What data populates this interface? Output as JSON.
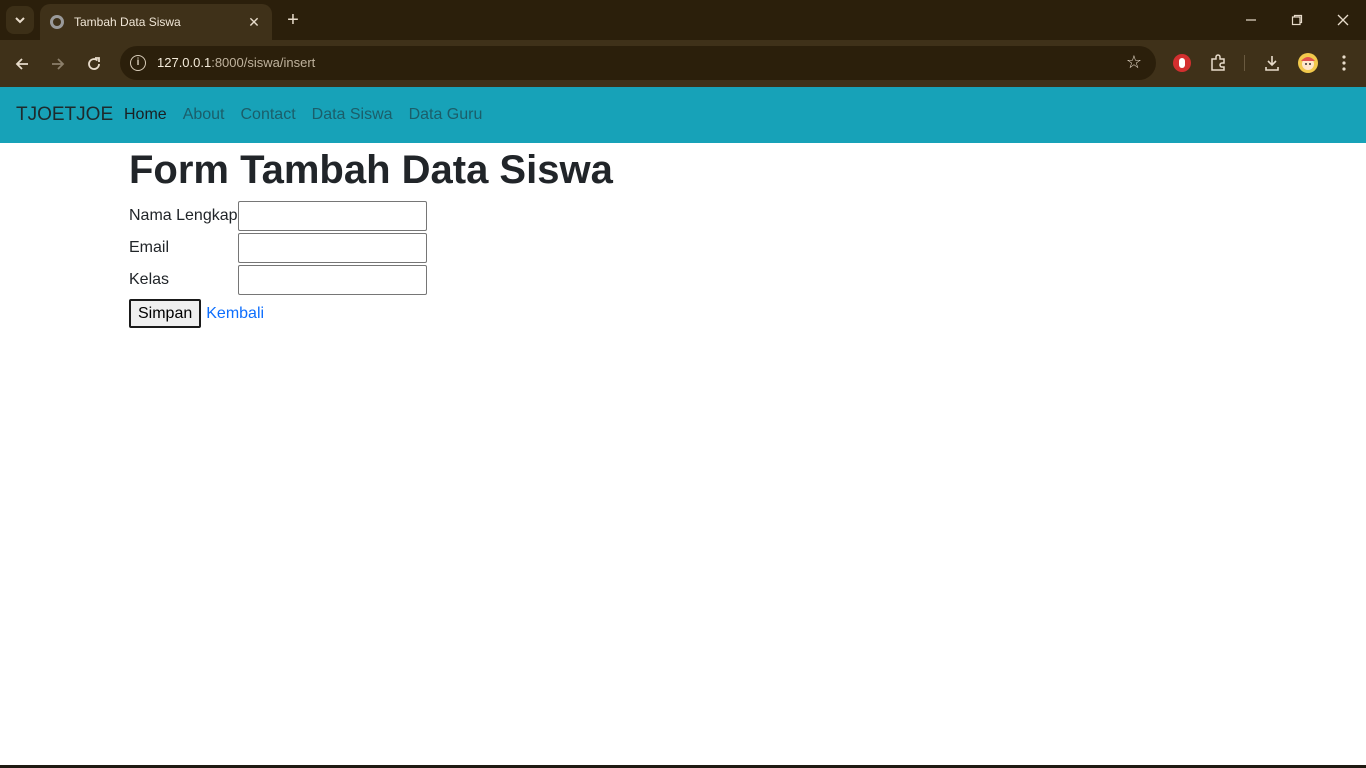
{
  "browser": {
    "tab_title": "Tambah Data Siswa",
    "tab_close": "✕",
    "new_tab": "+",
    "url_host": "127.0.0.1",
    "url_path": ":8000/siswa/insert",
    "window_controls": {
      "minimize": "─",
      "restore": "❐",
      "close": "✕"
    },
    "accent_color": "#3f3119"
  },
  "navbar": {
    "brand": "TJOETJOE",
    "links": [
      "Home",
      "About",
      "Contact",
      "Data Siswa",
      "Data Guru"
    ],
    "active": "Home",
    "background": "#17a2b8"
  },
  "form": {
    "heading": "Form Tambah Data Siswa",
    "fields": [
      {
        "label": "Nama Lengkap",
        "value": ""
      },
      {
        "label": "Email",
        "value": ""
      },
      {
        "label": "Kelas",
        "value": ""
      }
    ],
    "submit_label": "Simpan",
    "back_link": "Kembali"
  }
}
